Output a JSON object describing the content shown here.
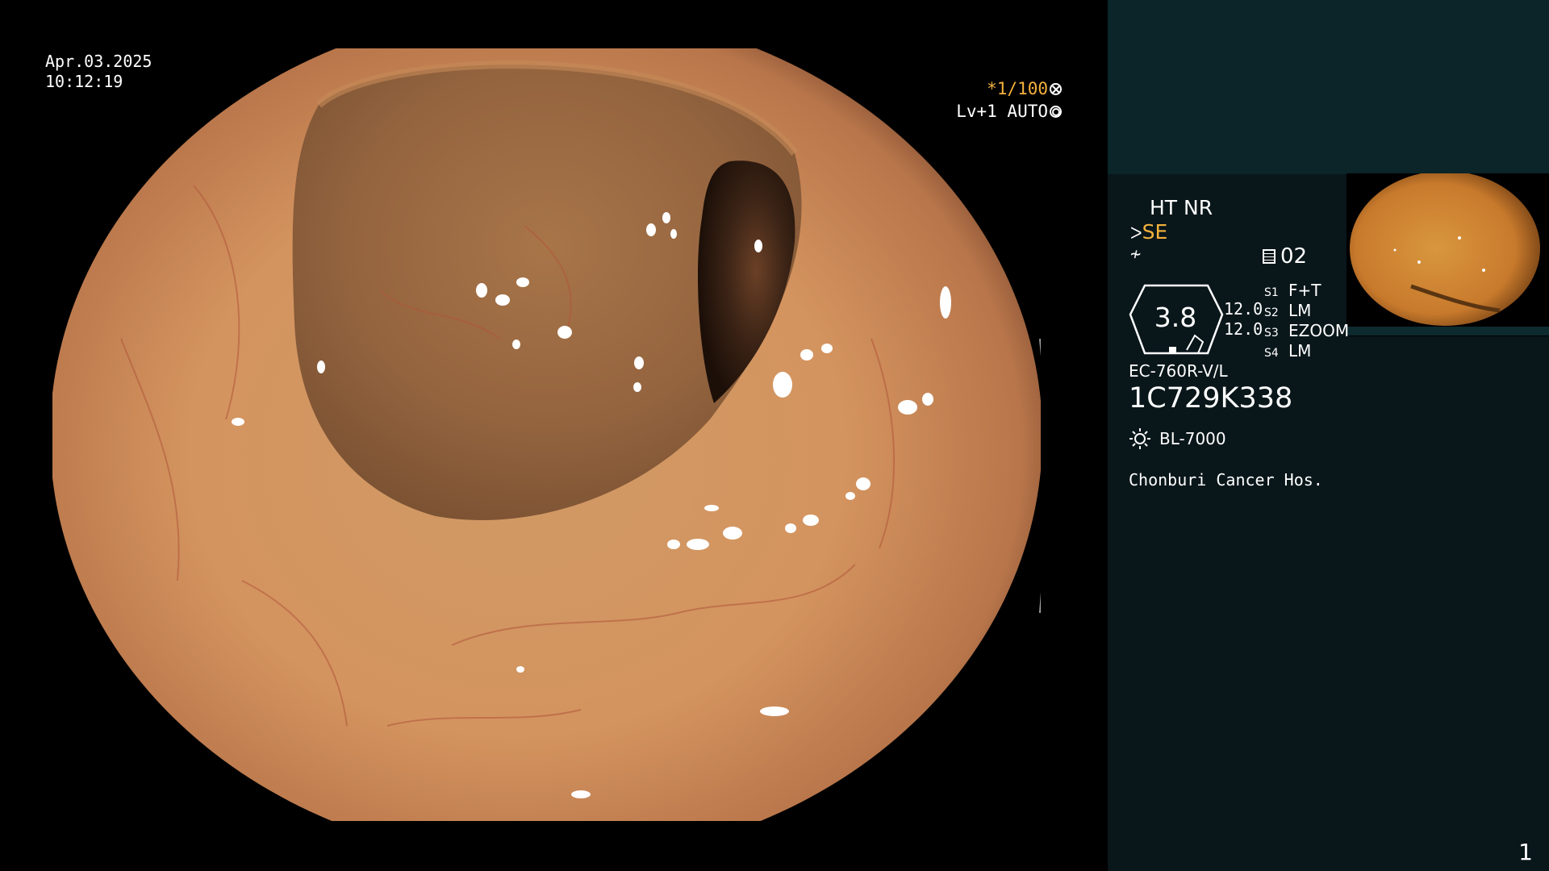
{
  "view": {
    "date": "Apr.03.2025",
    "time": "10:12:19",
    "shutter": "*1/100",
    "level": "Lv+1",
    "mode": "AUTO"
  },
  "panel": {
    "ht_nr": "HT NR",
    "se": "SE",
    "memory": "02",
    "gauge_value": "3.8",
    "value_a": "12.0",
    "value_b": "12.0",
    "switches": [
      {
        "key": "S1",
        "value": "F+T"
      },
      {
        "key": "S2",
        "value": "LM"
      },
      {
        "key": "S3",
        "value": "EZOOM"
      },
      {
        "key": "S4",
        "value": "LM"
      }
    ],
    "scope_model": "EC-760R-V/L",
    "scope_serial": "1C729K338",
    "light_source": "BL-7000",
    "hospital": "Chonburi Cancer Hos."
  },
  "page_number": "1",
  "colors": {
    "panel_bg": "#09161a",
    "panel_top": "#0b2529",
    "accent_orange": "#f4b13c"
  }
}
